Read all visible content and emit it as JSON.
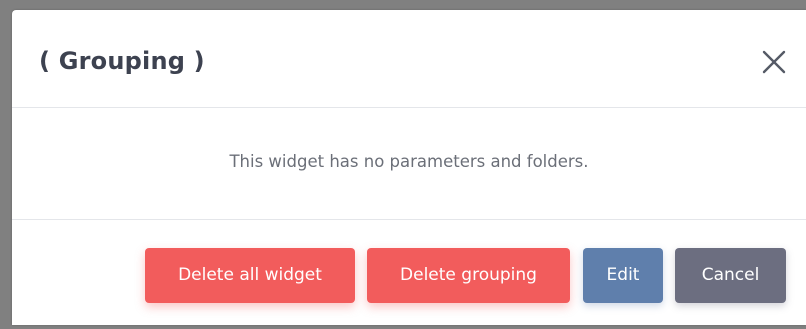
{
  "modal": {
    "title": "( Grouping )",
    "close_icon": "close-icon",
    "body_message": "This widget has no parameters and folders."
  },
  "footer": {
    "delete_all_label": "Delete all widget",
    "delete_grouping_label": "Delete grouping",
    "edit_label": "Edit",
    "cancel_label": "Cancel"
  },
  "colors": {
    "danger": "#f25c5c",
    "primary": "#5f7fac",
    "secondary": "#6c6e80",
    "title_text": "#3d4250",
    "muted_text": "#6b6f78"
  }
}
